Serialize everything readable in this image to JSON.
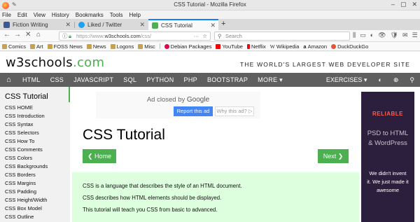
{
  "window": {
    "title": "CSS Tutorial - Mozilla Firefox",
    "minimize": "‒",
    "maximize": "▢",
    "close": "✕"
  },
  "menu": [
    "File",
    "Edit",
    "View",
    "History",
    "Bookmarks",
    "Tools",
    "Help"
  ],
  "tabs": [
    {
      "label": "Fiction Writing",
      "close": "✕",
      "icon_color": "#3b5998"
    },
    {
      "label": "Liked / Twitter",
      "close": "✕",
      "icon_color": "#1da1f2"
    },
    {
      "label": "CSS Tutorial",
      "close": "✕",
      "icon_color": "#4caf50",
      "active": true
    }
  ],
  "newtab": "+",
  "nav": {
    "back": "←",
    "forward": "→",
    "stop": "✕",
    "home": "⌂",
    "url_prefix": "https://www.",
    "url_host": "w3schools.com",
    "url_path": "/css/",
    "more": "···",
    "star": "☆",
    "search_placeholder": "Search",
    "tools": [
      "⫼",
      "▭",
      "◐",
      "👁",
      "🛡",
      "✉",
      "☰"
    ]
  },
  "bookmarks": [
    {
      "label": "Comics",
      "icon_color": "#c8a24a"
    },
    {
      "label": "Art",
      "icon_color": "#c8a24a"
    },
    {
      "label": "FOSS News",
      "icon_color": "#c8a24a"
    },
    {
      "label": "News",
      "icon_color": "#c8a24a"
    },
    {
      "label": "Logons",
      "icon_color": "#c8a24a"
    },
    {
      "label": "Misc",
      "icon_color": "#c8a24a"
    },
    {
      "label": "Debian Packages",
      "icon_color": "#d70751"
    },
    {
      "label": "YouTube",
      "icon_color": "#ff0000"
    },
    {
      "label": "Netflix",
      "icon_color": "#e50914"
    },
    {
      "label": "Wikipedia",
      "icon_color": "#333333"
    },
    {
      "label": "Amazon",
      "icon_color": "#222222"
    },
    {
      "label": "DuckDuckGo",
      "icon_color": "#de5833"
    }
  ],
  "site": {
    "logo_main": "w3schools",
    "logo_suffix": ".com",
    "slogan": "THE WORLD'S LARGEST WEB DEVELOPER SITE",
    "nav_home_icon": "⌂",
    "nav": [
      "HTML",
      "CSS",
      "JAVASCRIPT",
      "SQL",
      "PYTHON",
      "PHP",
      "BOOTSTRAP",
      "MORE ▾"
    ],
    "nav_right": {
      "exercises": "EXERCISES ▾",
      "theme": "◐",
      "translate": "⊕",
      "search": "⚲"
    },
    "accent": "#4caf50"
  },
  "sidebar": {
    "title": "CSS Tutorial",
    "items": [
      "CSS HOME",
      "CSS Introduction",
      "CSS Syntax",
      "CSS Selectors",
      "CSS How To",
      "CSS Comments",
      "CSS Colors",
      "CSS Backgrounds",
      "CSS Borders",
      "CSS Margins",
      "CSS Padding",
      "CSS Height/Width",
      "CSS Box Model",
      "CSS Outline"
    ]
  },
  "main": {
    "ad_closed": "Ad closed by ",
    "ad_google": "Google",
    "report_ad": "Report this ad",
    "why_ad": "Why this ad? ▷",
    "title": "CSS Tutorial",
    "home_btn": "❮ Home",
    "next_btn": "Next ❯",
    "intro": [
      "CSS is a language that describes the style of an HTML document.",
      "CSS describes how HTML elements should be displayed.",
      "This tutorial will teach you CSS from basic to advanced."
    ]
  },
  "right_ad": {
    "brand": "RELIABLE",
    "headline_1": "PSD to HTML",
    "headline_2": "& WordPress",
    "sub_1": "We didn't invent",
    "sub_2": "it. We just made it",
    "sub_3": "awesome"
  }
}
